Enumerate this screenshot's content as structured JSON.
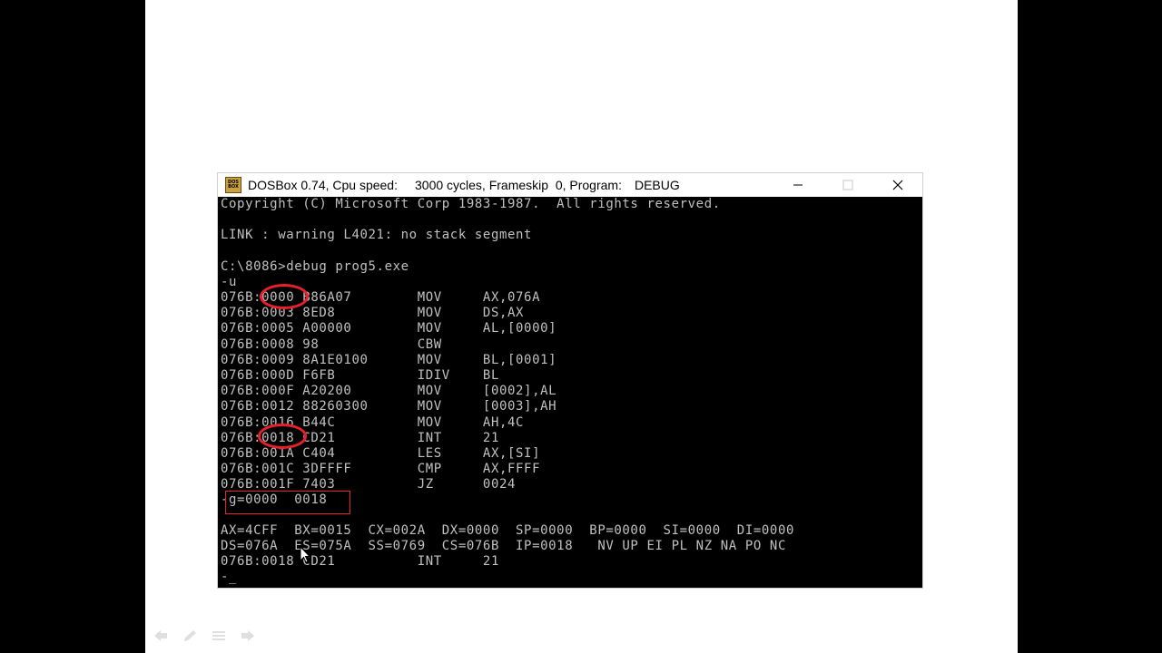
{
  "window": {
    "icon_text": [
      "DOS",
      "BOX"
    ],
    "title_name": "DOSBox 0.74, Cpu speed:",
    "title_speed": "3000 cycles, Frameskip  0, Program:",
    "title_program": "DEBUG",
    "minimize_icon": "minimize-icon",
    "maximize_icon": "maximize-icon",
    "close_icon": "close-icon"
  },
  "console": {
    "lines": [
      "Copyright (C) Microsoft Corp 1983-1987.  All rights reserved.",
      "",
      "LINK : warning L4021: no stack segment",
      "",
      "C:\\8086>debug prog5.exe",
      "-u",
      "076B:0000 B86A07        MOV     AX,076A",
      "076B:0003 8ED8          MOV     DS,AX",
      "076B:0005 A00000        MOV     AL,[0000]",
      "076B:0008 98            CBW",
      "076B:0009 8A1E0100      MOV     BL,[0001]",
      "076B:000D F6FB          IDIV    BL",
      "076B:000F A20200        MOV     [0002],AL",
      "076B:0012 88260300      MOV     [0003],AH",
      "076B:0016 B44C          MOV     AH,4C",
      "076B:0018 CD21          INT     21",
      "076B:001A C404          LES     AX,[SI]",
      "076B:001C 3DFFFF        CMP     AX,FFFF",
      "076B:001F 7403          JZ      0024",
      "-g=0000  0018",
      "",
      "AX=4CFF  BX=0015  CX=002A  DX=0000  SP=0000  BP=0000  SI=0000  DI=0000",
      "DS=076A  ES=075A  SS=0769  CS=076B  IP=0018   NV UP EI PL NZ NA PO NC",
      "076B:0018 CD21          INT     21",
      "-_"
    ]
  },
  "annotation_color": "#e8202a",
  "console_text_color": "#c0c0c0"
}
